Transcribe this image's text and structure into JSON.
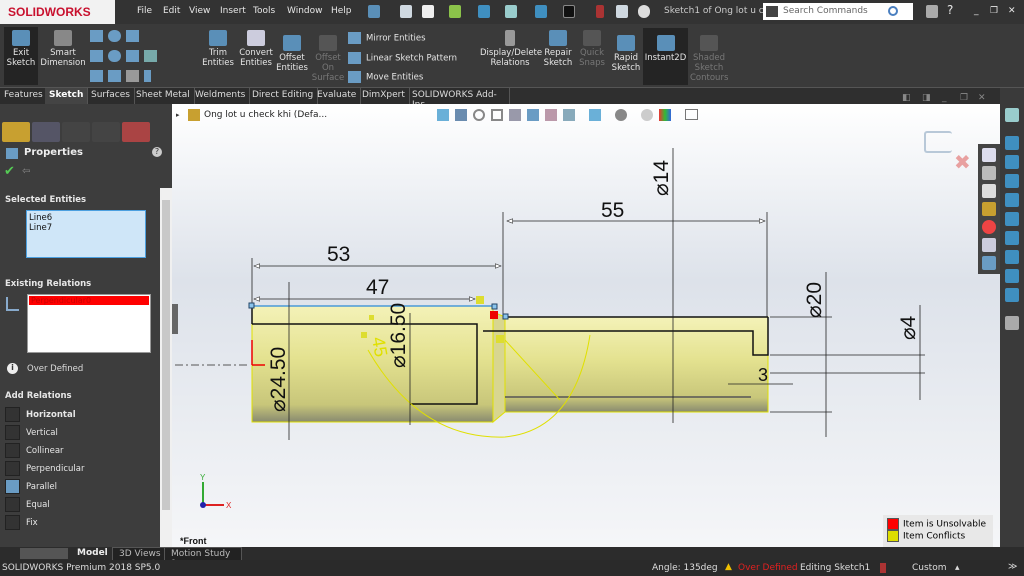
{
  "app": {
    "brand": "SOLIDWORKS",
    "window_title": "Sketch1 of Ong lot u c...",
    "search_placeholder": "Search Commands"
  },
  "menu": [
    "File",
    "Edit",
    "View",
    "Insert",
    "Tools",
    "Window",
    "Help"
  ],
  "ribbon": {
    "exit_sketch": "Exit Sketch",
    "smart_dimension": "Smart Dimension",
    "trim": "Trim Entities",
    "convert": "Convert Entities",
    "offset": "Offset Entities",
    "offset_surface": "Offset On Surface",
    "mirror": "Mirror Entities",
    "linear_pattern": "Linear Sketch Pattern",
    "move": "Move Entities",
    "display_delete": "Display/Delete Relations",
    "repair": "Repair Sketch",
    "quick_snaps": "Quick Snaps",
    "rapid": "Rapid Sketch",
    "instant2d": "Instant2D",
    "shaded": "Shaded Sketch Contours"
  },
  "tabs": [
    "Features",
    "Sketch",
    "Surfaces",
    "Sheet Metal",
    "Weldments",
    "Direct Editing",
    "Evaluate",
    "DimXpert",
    "SOLIDWORKS Add-Ins"
  ],
  "active_tab": "Sketch",
  "tree": {
    "part": "Ong lot u check khi  (Defa..."
  },
  "panel": {
    "title": "Properties",
    "selected_header": "Selected Entities",
    "selected": [
      "Line6",
      "Line7"
    ],
    "existing_header": "Existing Relations",
    "existing": [
      "Perpendicular0"
    ],
    "status": "Over Defined",
    "add_header": "Add Relations",
    "add": [
      "Horizontal",
      "Vertical",
      "Collinear",
      "Perpendicular",
      "Parallel",
      "Equal",
      "Fix"
    ]
  },
  "dimensions": {
    "d53": "53",
    "d47": "47",
    "d55": "55",
    "d14": "⌀14",
    "d20": "⌀20",
    "d4": "⌀4",
    "d2450": "⌀24.50",
    "d1650": "⌀16.50",
    "d3": "3",
    "angle": "45"
  },
  "view": {
    "name": "*Front",
    "axis_x": "X",
    "axis_y": "Y"
  },
  "legend": {
    "unsolvable": "Item is Unsolvable",
    "conflicts": "Item Conflicts",
    "unsolvable_color": "#ff0000",
    "conflicts_color": "#e0e000"
  },
  "bottom_tabs": [
    "Model",
    "3D Views",
    "Motion Study 1"
  ],
  "status": {
    "product": "SOLIDWORKS Premium 2018 SP5.0",
    "angle": "Angle: 135deg",
    "state": "Over Defined",
    "editing": "Editing Sketch1",
    "units": "Custom"
  },
  "colors": {
    "sketch_fill": "#e8e6a0",
    "over_defined": "#ff2020",
    "accent": "#5a8fb8"
  }
}
